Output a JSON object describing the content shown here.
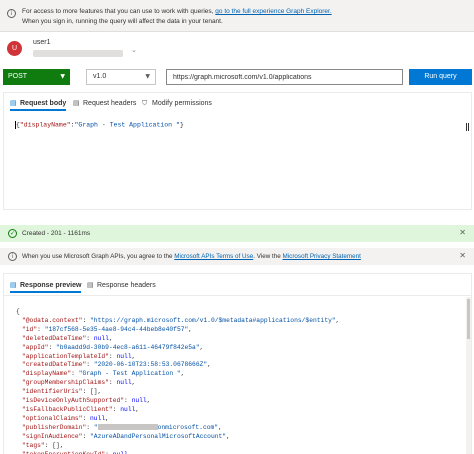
{
  "banner": {
    "text1": "For access to more features that you can use to work with queries, ",
    "link": "go to the full experience Graph Explorer.",
    "text2": "When you sign in, running the query will affect the data in your tenant."
  },
  "user": {
    "avatar_initial": "U",
    "name": "user1"
  },
  "query": {
    "method": "POST",
    "version": "v1.0",
    "url": "https://graph.microsoft.com/v1.0/applications",
    "run_label": "Run query"
  },
  "request_tabs": {
    "body": "Request body",
    "headers": "Request headers",
    "permissions": "Modify permissions"
  },
  "request_body": {
    "open": "{",
    "key": "\"displayName\"",
    "colon": ":",
    "value": "\"Graph - Test Application \"",
    "close": "}"
  },
  "status": {
    "text": "Created - 201 - 1161ms"
  },
  "terms": {
    "t1": "When you use Microsoft Graph APIs, you agree to the ",
    "link1": "Microsoft APIs Terms of Use",
    "t2": ". View the ",
    "link2": "Microsoft Privacy Statement"
  },
  "response_tabs": {
    "preview": "Response preview",
    "headers": "Response headers"
  },
  "response": {
    "open": "{",
    "lines": [
      {
        "k": "\"@odata.context\"",
        "v": "\"https://graph.microsoft.com/v1.0/$metadata#applications/$entity\"",
        "t": "s"
      },
      {
        "k": "\"id\"",
        "v": "\"187cf568-5e35-4ae8-94c4-44beb8e40f57\"",
        "t": "s"
      },
      {
        "k": "\"deletedDateTime\"",
        "v": "null",
        "t": "n"
      },
      {
        "k": "\"appId\"",
        "v": "\"b0aadd9d-30b9-4ec8-a611-46479f842e5a\"",
        "t": "s"
      },
      {
        "k": "\"applicationTemplateId\"",
        "v": "null",
        "t": "n"
      },
      {
        "k": "\"createdDateTime\"",
        "v": "\"2020-06-10T23:58:53.0678666Z\"",
        "t": "s"
      },
      {
        "k": "\"displayName\"",
        "v": "\"Graph - Test Application \"",
        "t": "s"
      },
      {
        "k": "\"groupMembershipClaims\"",
        "v": "null",
        "t": "n"
      },
      {
        "k": "\"identifierUris\"",
        "v": "[]",
        "t": "p"
      },
      {
        "k": "\"isDeviceOnlyAuthSupported\"",
        "v": "null",
        "t": "n"
      },
      {
        "k": "\"isFallbackPublicClient\"",
        "v": "null",
        "t": "n"
      },
      {
        "k": "\"optionalClaims\"",
        "v": "null",
        "t": "n"
      },
      {
        "k": "\"publisherDomain\"",
        "v": "onmicrosoft.com\"",
        "t": "r"
      },
      {
        "k": "\"signInAudience\"",
        "v": "\"AzureADandPersonalMicrosoftAccount\"",
        "t": "s"
      },
      {
        "k": "\"tags\"",
        "v": "[]",
        "t": "p"
      },
      {
        "k": "\"tokenEncryptionKeyId\"",
        "v": "null",
        "t": "n"
      }
    ]
  },
  "colors": {
    "accent": "#0078d4",
    "method_green": "#107c10",
    "success_bg": "#dff6dd",
    "avatar": "#d13438"
  },
  "icons": {
    "banner": "info-icon",
    "status": "check-circle-icon",
    "terms": "info-icon",
    "close": "close-icon"
  }
}
